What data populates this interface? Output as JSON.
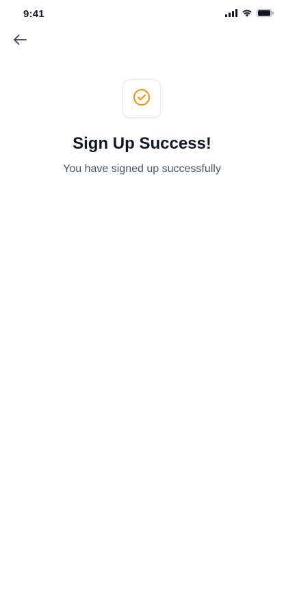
{
  "status_bar": {
    "time": "9:41",
    "icons": [
      "cellular-signal-icon",
      "wifi-icon",
      "battery-icon"
    ]
  },
  "header": {
    "back_icon": "arrow-left-icon"
  },
  "main": {
    "icon": "check-circle-icon",
    "title": "Sign Up Success!",
    "subtitle": "You have signed up successfully"
  },
  "colors": {
    "accent": "#F79009",
    "text_primary": "#101828",
    "text_secondary": "#475467",
    "border": "#E4E7EC",
    "icon_gray": "#344054"
  }
}
